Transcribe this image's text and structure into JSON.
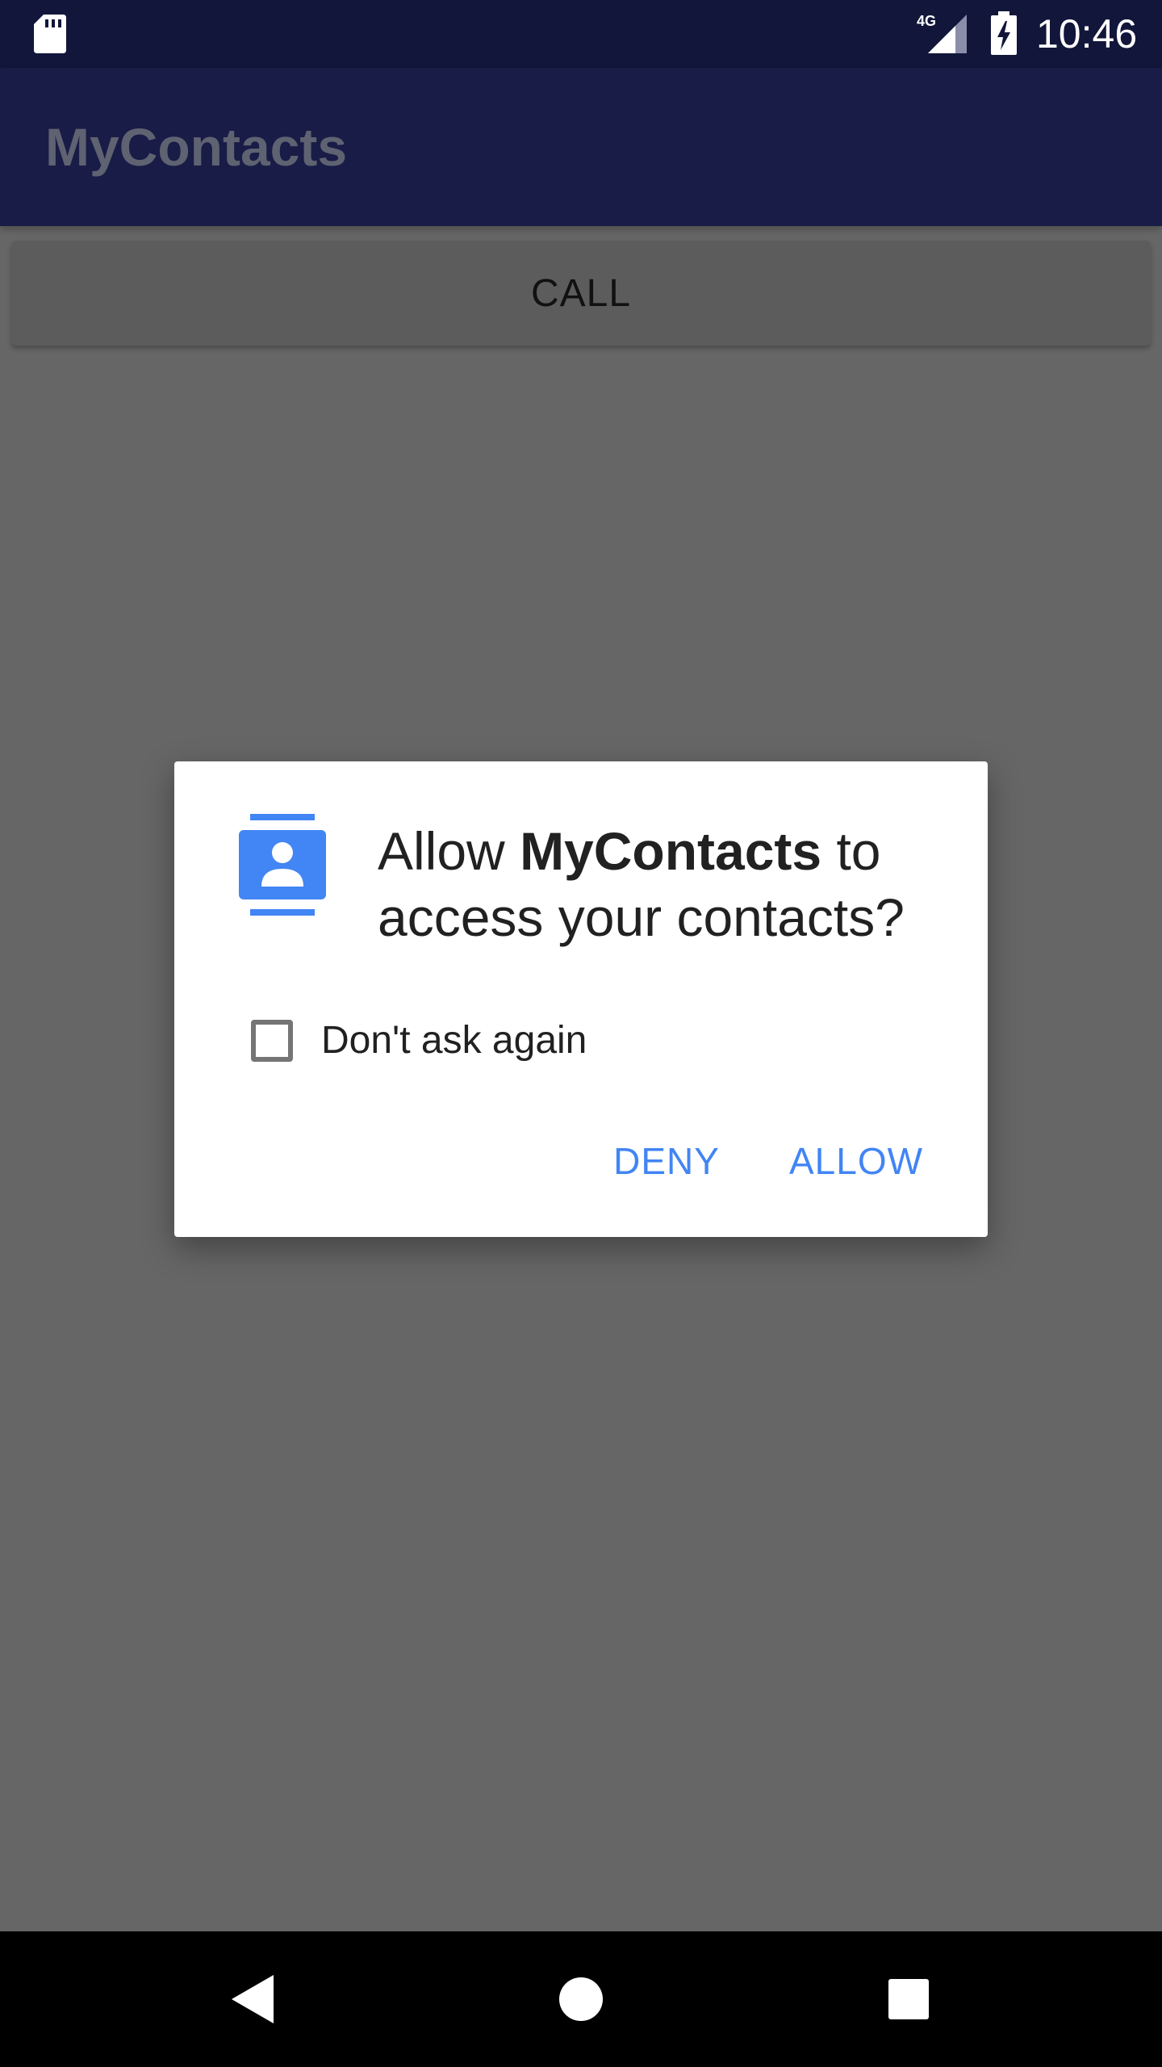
{
  "status_bar": {
    "time": "10:46",
    "network": "4G",
    "icons": [
      "sd-card-icon",
      "signal-icon",
      "battery-charging-icon"
    ]
  },
  "app_bar": {
    "title": "MyContacts"
  },
  "main": {
    "call_label": "CALL"
  },
  "dialog": {
    "title_prefix": "Allow ",
    "title_app": "MyContacts",
    "title_suffix": " to access your contacts?",
    "icon": "contacts-icon",
    "checkbox_label": "Don't ask again",
    "checkbox_checked": false,
    "deny_label": "DENY",
    "allow_label": "ALLOW",
    "accent_color": "#4285f4"
  },
  "nav_bar": {
    "icons": [
      "back-icon",
      "home-icon",
      "recents-icon"
    ]
  }
}
